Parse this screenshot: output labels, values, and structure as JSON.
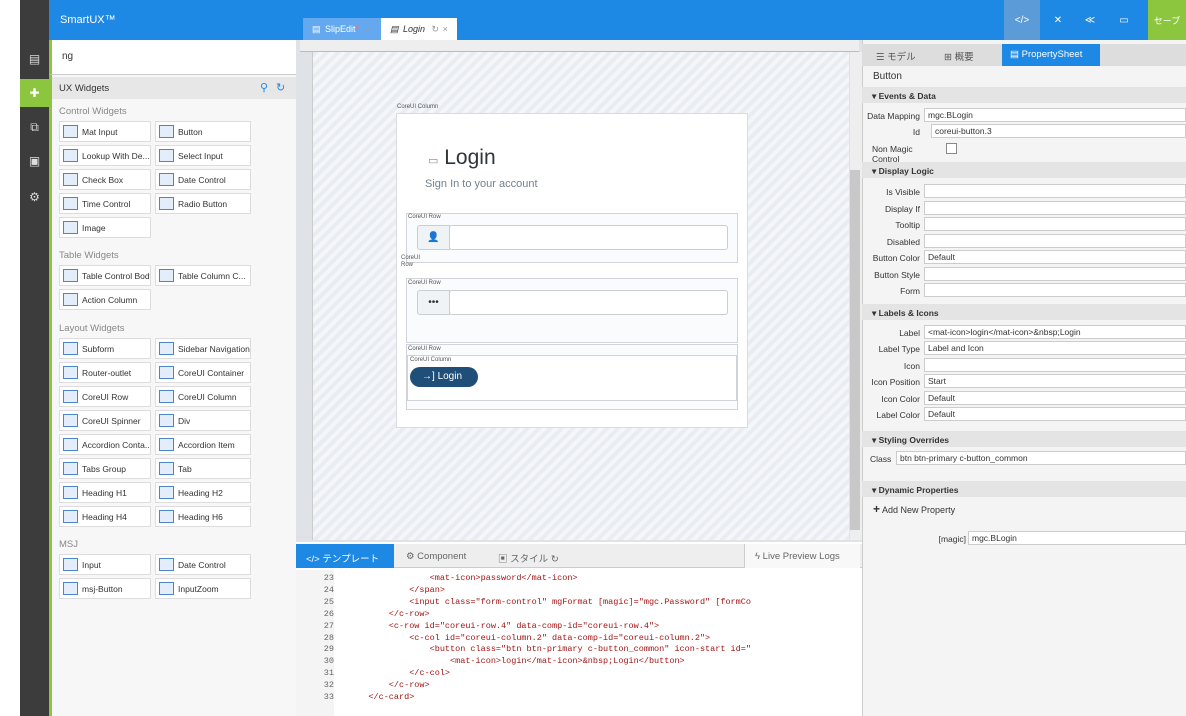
{
  "app": {
    "brand": "SmartUX™"
  },
  "rail": {
    "items": [
      "page-icon",
      "puzzle-icon",
      "copy-icon",
      "image-icon",
      "gear-icon"
    ]
  },
  "tabs": [
    {
      "label": "SlipEdit",
      "dirty": "*",
      "close": "×"
    },
    {
      "label": "Login",
      "sync": "↻",
      "close": "×"
    }
  ],
  "toolbar": {
    "items": [
      "code-icon",
      "collapse-icon",
      "share-icon",
      "monitor-icon"
    ],
    "save": "セーブ"
  },
  "left": {
    "filter": "ng",
    "panel_title": "UX Widgets",
    "sections": {
      "control": "Control Widgets",
      "table": "Table Widgets",
      "layout": "Layout Widgets",
      "msj": "MSJ"
    },
    "control_widgets": [
      "Mat Input",
      "Button",
      "Lookup With De...",
      "Select Input",
      "Check Box",
      "Date Control",
      "Time Control",
      "Radio Button",
      "Image"
    ],
    "table_widgets": [
      "Table Control Body",
      "Table Column C...",
      "Action Column"
    ],
    "layout_widgets": [
      "Subform",
      "Sidebar Navigation",
      "Router-outlet",
      "CoreUI Container",
      "CoreUI Row",
      "CoreUI Column",
      "CoreUI Spinner",
      "Div",
      "Accordion Conta...",
      "Accordion Item",
      "Tabs Group",
      "Tab",
      "Heading H1",
      "Heading H2",
      "Heading H4",
      "Heading H6"
    ],
    "msj_widgets": [
      "Input",
      "Date Control",
      "msj-Button",
      "InputZoom"
    ]
  },
  "canvas": {
    "column_caption": "CoreUI Column",
    "title": "Login",
    "subtitle": "Sign In to your account",
    "row_caption": "CoreUI Row",
    "row_caption_split": "CoreUI\nRow",
    "inner_column_caption": "CoreUI Column",
    "button_label": "Login"
  },
  "bottom": {
    "tabs": [
      "テンプレート",
      "Component",
      "スタイル",
      "Live Preview Logs"
    ],
    "lines": [
      {
        "n": "23",
        "code": "                <mat-icon>password</mat-icon>"
      },
      {
        "n": "24",
        "code": "            </span>"
      },
      {
        "n": "25",
        "code": "            <input class=\"form-control\" mgFormat [magic]=\"mgc.Password\" [formCo"
      },
      {
        "n": "26",
        "code": "        </c-row>"
      },
      {
        "n": "27",
        "code": "        <c-row id=\"coreui-row.4\" data-comp-id=\"coreui-row.4\">"
      },
      {
        "n": "28",
        "code": "            <c-col id=\"coreui-column.2\" data-comp-id=\"coreui-column.2\">"
      },
      {
        "n": "29",
        "code": "                <button class=\"btn btn-primary c-button_common\" icon-start id=\""
      },
      {
        "n": "30",
        "code": "                    <mat-icon>login</mat-icon>&nbsp;Login</button>"
      },
      {
        "n": "31",
        "code": "            </c-col>"
      },
      {
        "n": "32",
        "code": "        </c-row>"
      },
      {
        "n": "33",
        "code": "    </c-card>"
      }
    ]
  },
  "props": {
    "tabs": [
      "モデル",
      "概要",
      "PropertySheet"
    ],
    "element": "Button",
    "events_header": "Events & Data",
    "data_mapping_label": "Data Mapping",
    "data_mapping": "mgc.BLogin",
    "id_label": "Id",
    "id": "coreui-button.3",
    "non_magic_label": "Non Magic Control",
    "display_header": "Display Logic",
    "display_labels": [
      "Is Visible",
      "Display If",
      "Tooltip",
      "Disabled",
      "Button Color",
      "Button Style",
      "Form"
    ],
    "button_color": "Default",
    "labels_header": "Labels & Icons",
    "label_label": "Label",
    "label": "<mat-icon>login</mat-icon>&nbsp;Login",
    "label_type_label": "Label Type",
    "label_type": "Label and Icon",
    "icon_label": "Icon",
    "icon_position_label": "Icon Position",
    "icon_position": "Start",
    "icon_color_label": "Icon Color",
    "icon_color": "Default",
    "label_color_label": "Label Color",
    "label_color": "Default",
    "styling_header": "Styling Overrides",
    "class_label": "Class",
    "class_value": "btn btn-primary c-button_common",
    "dynamic_header": "Dynamic Properties",
    "add_new": "Add New Property",
    "magic_label": "[magic]",
    "magic_value": "mgc.BLogin"
  }
}
